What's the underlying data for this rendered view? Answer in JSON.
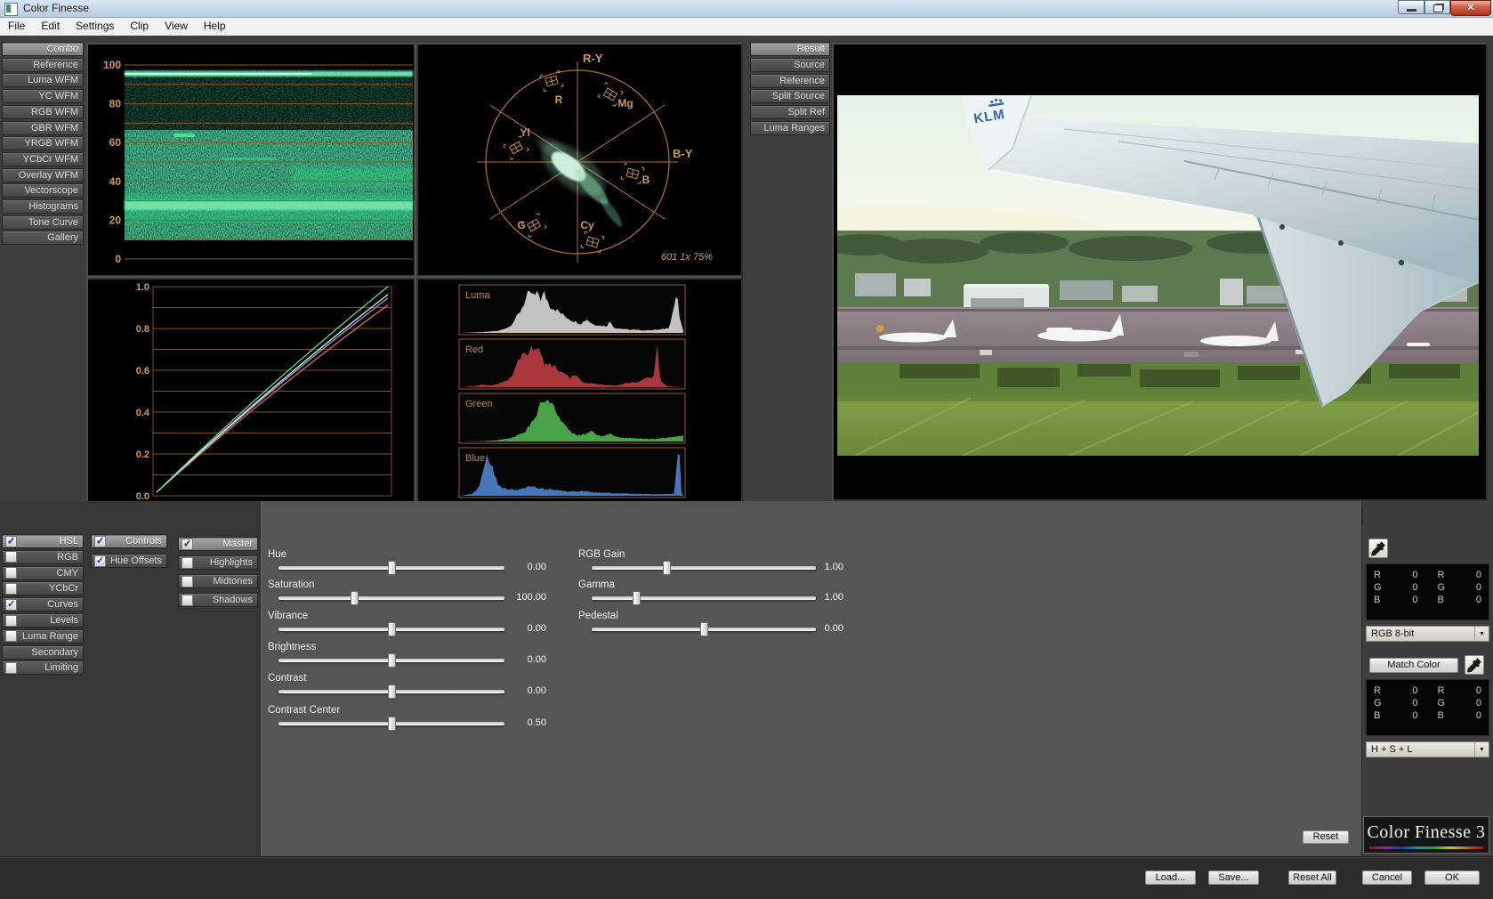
{
  "window": {
    "title": "Color Finesse"
  },
  "menu_bar": {
    "items": [
      "File",
      "Edit",
      "Settings",
      "Clip",
      "View",
      "Help"
    ]
  },
  "scope_tabs": [
    {
      "label": "Combo",
      "selected": true
    },
    {
      "label": "Reference"
    },
    {
      "label": "Luma WFM"
    },
    {
      "label": "YC WFM"
    },
    {
      "label": "RGB WFM"
    },
    {
      "label": "GBR WFM"
    },
    {
      "label": "YRGB WFM"
    },
    {
      "label": "YCbCr WFM"
    },
    {
      "label": "Overlay WFM"
    },
    {
      "label": "Vectorscope"
    },
    {
      "label": "Histograms"
    },
    {
      "label": "Tone Curve"
    },
    {
      "label": "Gallery"
    }
  ],
  "view_tabs": [
    {
      "label": "Result",
      "selected": true
    },
    {
      "label": "Source"
    },
    {
      "label": "Reference"
    },
    {
      "label": "Split Source"
    },
    {
      "label": "Split Ref"
    },
    {
      "label": "Luma Ranges"
    }
  ],
  "waveform": {
    "scale_labels": [
      "100",
      "80",
      "60",
      "40",
      "20",
      "0"
    ],
    "graticule_color": "#8a5a28",
    "trace_color": "#2ee08a"
  },
  "vectorscope": {
    "axis_top": "R-Y",
    "axis_right": "B-Y",
    "targets": [
      "R",
      "Mg",
      "Yl",
      "B",
      "G",
      "Cy"
    ],
    "status": "601 1x 75%"
  },
  "tone_curve": {
    "scale_labels": [
      "1.0",
      "0.8",
      "0.6",
      "0.4",
      "0.2",
      "0.0"
    ],
    "curves": [
      {
        "name": "red",
        "color": "#d96a60",
        "end_rise": 0.912
      },
      {
        "name": "blue",
        "color": "#8fa8e0",
        "end_rise": 0.945
      },
      {
        "name": "gray",
        "color": "#ececec",
        "end_rise": 0.962
      },
      {
        "name": "green",
        "color": "#63d890",
        "end_rise": 1.0
      }
    ]
  },
  "histograms": {
    "panels": [
      {
        "label": "Luma",
        "color": "#cccccc",
        "profile": [
          [
            0,
            0
          ],
          [
            0.1,
            0.02
          ],
          [
            0.17,
            0.05
          ],
          [
            0.22,
            0.15
          ],
          [
            0.26,
            0.45
          ],
          [
            0.29,
            0.78
          ],
          [
            0.31,
            1.0
          ],
          [
            0.33,
            0.85
          ],
          [
            0.345,
            1.0
          ],
          [
            0.36,
            0.8
          ],
          [
            0.375,
            0.95
          ],
          [
            0.4,
            0.65
          ],
          [
            0.43,
            0.55
          ],
          [
            0.46,
            0.42
          ],
          [
            0.5,
            0.3
          ],
          [
            0.54,
            0.22
          ],
          [
            0.565,
            0.33
          ],
          [
            0.59,
            0.22
          ],
          [
            0.62,
            0.18
          ],
          [
            0.655,
            0.16
          ],
          [
            0.67,
            0.28
          ],
          [
            0.69,
            0.12
          ],
          [
            0.75,
            0.08
          ],
          [
            0.83,
            0.06
          ],
          [
            0.9,
            0.08
          ],
          [
            0.935,
            0.12
          ],
          [
            0.955,
            0.55
          ],
          [
            0.97,
            0.95
          ],
          [
            0.985,
            0.3
          ],
          [
            1,
            0.05
          ]
        ]
      },
      {
        "label": "Red",
        "color": "#b23a40",
        "profile": [
          [
            0,
            0
          ],
          [
            0.07,
            0.03
          ],
          [
            0.1,
            0.06
          ],
          [
            0.13,
            0.04
          ],
          [
            0.17,
            0.08
          ],
          [
            0.22,
            0.2
          ],
          [
            0.255,
            0.55
          ],
          [
            0.28,
            0.95
          ],
          [
            0.3,
            0.75
          ],
          [
            0.315,
            1.0
          ],
          [
            0.33,
            0.8
          ],
          [
            0.35,
            0.9
          ],
          [
            0.37,
            0.6
          ],
          [
            0.4,
            0.55
          ],
          [
            0.43,
            0.45
          ],
          [
            0.46,
            0.35
          ],
          [
            0.49,
            0.22
          ],
          [
            0.52,
            0.28
          ],
          [
            0.55,
            0.12
          ],
          [
            0.6,
            0.08
          ],
          [
            0.65,
            0.05
          ],
          [
            0.7,
            0.04
          ],
          [
            0.75,
            0.1
          ],
          [
            0.79,
            0.12
          ],
          [
            0.82,
            0.18
          ],
          [
            0.85,
            0.22
          ],
          [
            0.872,
            0.3
          ],
          [
            0.878,
            1.0
          ],
          [
            0.886,
            1.0
          ],
          [
            0.895,
            0.15
          ],
          [
            0.93,
            0.02
          ],
          [
            1,
            0
          ]
        ]
      },
      {
        "label": "Green",
        "color": "#4dad4d",
        "profile": [
          [
            0,
            0
          ],
          [
            0.1,
            0.01
          ],
          [
            0.18,
            0.04
          ],
          [
            0.24,
            0.1
          ],
          [
            0.29,
            0.25
          ],
          [
            0.33,
            0.55
          ],
          [
            0.36,
            0.9
          ],
          [
            0.385,
            1.0
          ],
          [
            0.41,
            0.92
          ],
          [
            0.44,
            0.6
          ],
          [
            0.47,
            0.35
          ],
          [
            0.5,
            0.2
          ],
          [
            0.53,
            0.14
          ],
          [
            0.56,
            0.18
          ],
          [
            0.585,
            0.25
          ],
          [
            0.61,
            0.16
          ],
          [
            0.64,
            0.12
          ],
          [
            0.67,
            0.18
          ],
          [
            0.7,
            0.1
          ],
          [
            0.75,
            0.08
          ],
          [
            0.8,
            0.07
          ],
          [
            0.85,
            0.06
          ],
          [
            0.9,
            0.07
          ],
          [
            0.95,
            0.1
          ],
          [
            1,
            0.14
          ]
        ]
      },
      {
        "label": "Blue",
        "color": "#4b7dc2",
        "profile": [
          [
            0,
            0
          ],
          [
            0.05,
            0.05
          ],
          [
            0.08,
            0.2
          ],
          [
            0.1,
            0.6
          ],
          [
            0.115,
            1.0
          ],
          [
            0.13,
            0.9
          ],
          [
            0.15,
            0.5
          ],
          [
            0.17,
            0.25
          ],
          [
            0.2,
            0.18
          ],
          [
            0.24,
            0.14
          ],
          [
            0.28,
            0.16
          ],
          [
            0.32,
            0.25
          ],
          [
            0.35,
            0.18
          ],
          [
            0.4,
            0.15
          ],
          [
            0.45,
            0.12
          ],
          [
            0.5,
            0.1
          ],
          [
            0.55,
            0.12
          ],
          [
            0.6,
            0.08
          ],
          [
            0.65,
            0.07
          ],
          [
            0.7,
            0.06
          ],
          [
            0.78,
            0.05
          ],
          [
            0.85,
            0.04
          ],
          [
            0.92,
            0.04
          ],
          [
            0.96,
            0.05
          ],
          [
            0.975,
            1.0
          ],
          [
            0.985,
            1.0
          ],
          [
            0.99,
            0.1
          ],
          [
            1,
            0
          ]
        ]
      }
    ]
  },
  "preview": {
    "wing_logo": "KLM"
  },
  "correction_tabs": [
    {
      "label": "HSL",
      "checkbox": true,
      "checked": true,
      "selected": true
    },
    {
      "label": "RGB",
      "checkbox": true
    },
    {
      "label": "CMY",
      "checkbox": true
    },
    {
      "label": "YCbCr",
      "checkbox": true
    },
    {
      "label": "Curves",
      "checkbox": true,
      "checked": true
    },
    {
      "label": "Levels",
      "checkbox": true
    },
    {
      "label": "Luma Range",
      "checkbox": true
    },
    {
      "label": "Secondary",
      "checkbox": false
    },
    {
      "label": "Limiting",
      "checkbox": true
    }
  ],
  "controls_tabs": [
    {
      "label": "Controls",
      "checkbox": true,
      "checked": true,
      "selected": true
    },
    {
      "label": "Hue Offsets",
      "checkbox": true,
      "checked": true
    }
  ],
  "tonal_tabs": [
    {
      "label": "Master",
      "checkbox": true,
      "checked": true,
      "selected": true
    },
    {
      "label": "Highlights",
      "checkbox": true
    },
    {
      "label": "Midtones",
      "checkbox": true
    },
    {
      "label": "Shadows",
      "checkbox": true
    }
  ],
  "sliders": {
    "left": [
      {
        "label": "Hue",
        "value": "0.00",
        "pos": 0.5
      },
      {
        "label": "Saturation",
        "value": "100.00",
        "pos": 0.33
      },
      {
        "label": "Vibrance",
        "value": "0.00",
        "pos": 0.5
      },
      {
        "label": "Brightness",
        "value": "0.00",
        "pos": 0.5
      },
      {
        "label": "Contrast",
        "value": "0.00",
        "pos": 0.5
      },
      {
        "label": "Contrast Center",
        "value": "0.50",
        "pos": 0.5
      }
    ],
    "right": [
      {
        "label": "RGB Gain",
        "value": "1.00",
        "pos": 0.33
      },
      {
        "label": "Gamma",
        "value": "1.00",
        "pos": 0.19
      },
      {
        "label": "Pedestal",
        "value": "0.00",
        "pos": 0.5
      }
    ]
  },
  "color_info": {
    "top": {
      "rows": [
        [
          "R",
          "0",
          "R",
          "0"
        ],
        [
          "G",
          "0",
          "G",
          "0"
        ],
        [
          "B",
          "0",
          "B",
          "0"
        ]
      ],
      "depth": "RGB 8-bit"
    },
    "bottom": {
      "match_button": "Match Color",
      "rows": [
        [
          "R",
          "0",
          "R",
          "0"
        ],
        [
          "G",
          "0",
          "G",
          "0"
        ],
        [
          "B",
          "0",
          "B",
          "0"
        ]
      ],
      "mode": "H + S + L"
    }
  },
  "footer": {
    "reset": "Reset",
    "logo": "Color Finesse 3",
    "load": "Load...",
    "save": "Save...",
    "reset_all": "Reset All",
    "cancel": "Cancel",
    "ok": "OK"
  }
}
